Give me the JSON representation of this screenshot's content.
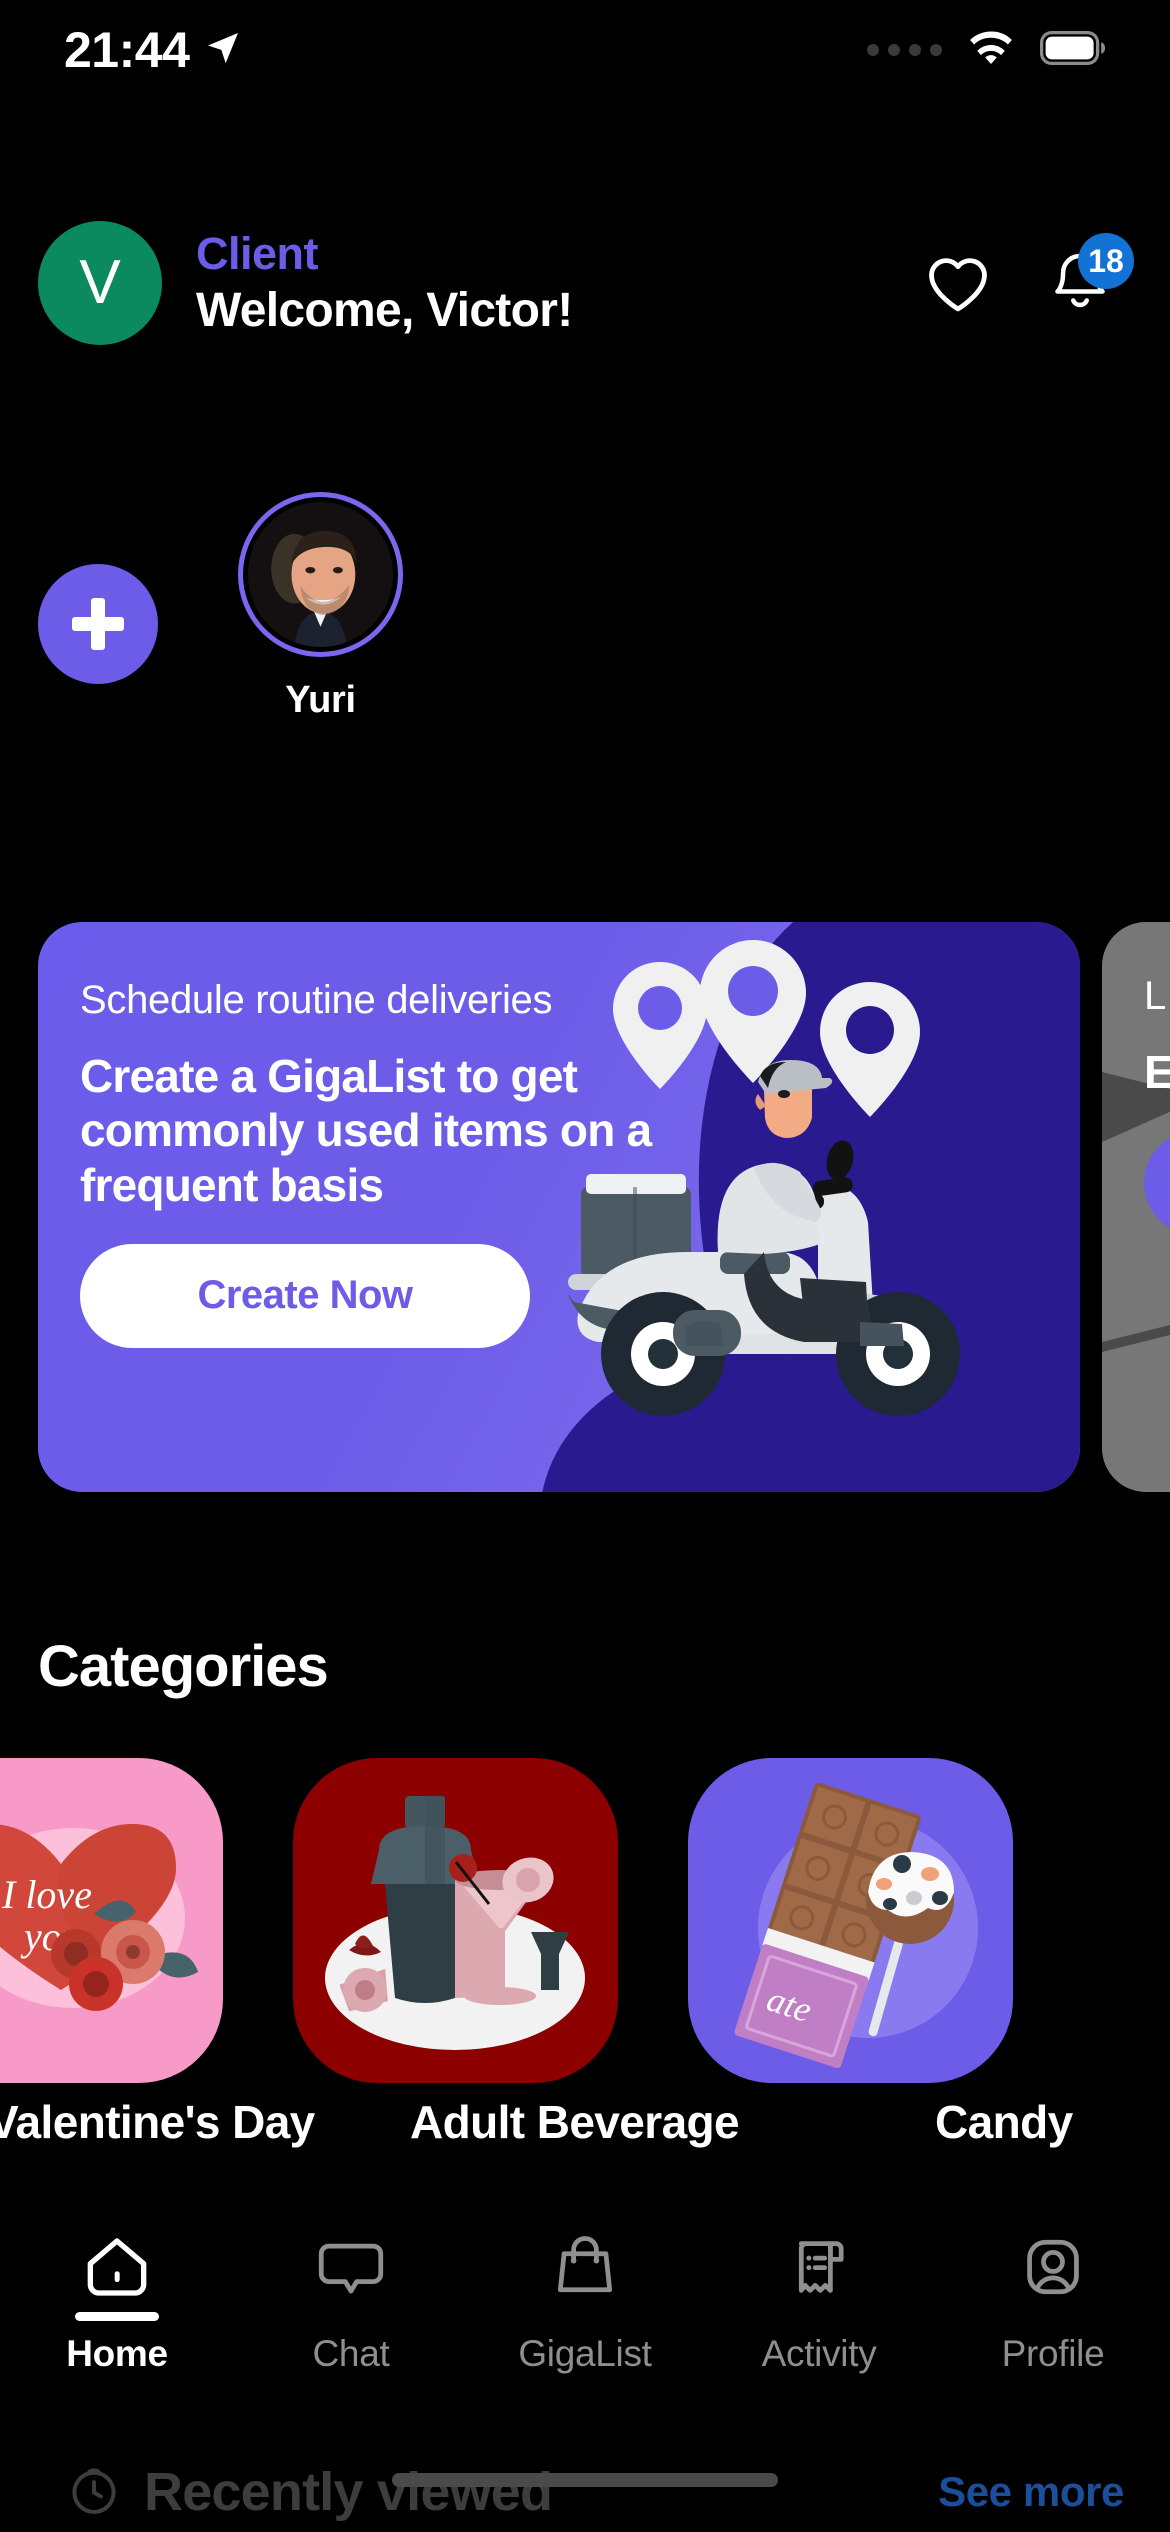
{
  "status_bar": {
    "time": "21:44",
    "location_icon": "location-arrow-icon",
    "signal_icon": "signal-dots-icon",
    "wifi_icon": "wifi-icon",
    "battery_icon": "battery-full-icon"
  },
  "header": {
    "avatar_initial": "V",
    "avatar_color": "#0b8a60",
    "role": "Client",
    "role_color": "#6C5CE7",
    "welcome": "Welcome, Victor!",
    "favorites_icon": "heart-icon",
    "notifications_icon": "bell-icon",
    "notification_count": "18",
    "badge_color": "#1273d4"
  },
  "stories": {
    "add_label": "plus-icon",
    "items": [
      {
        "name": "Yuri",
        "ring_color": "#7B66F0"
      }
    ]
  },
  "banners": [
    {
      "kicker": "Schedule routine deliveries",
      "title": "Create a GigaList to get commonly used items on a frequent basis",
      "button": "Create Now",
      "bg_color": "#6C5CE7",
      "button_text_color": "#6C5CE7",
      "art": "delivery-scooter-illustration"
    },
    {
      "kicker": "L",
      "title": "E i s",
      "button": "",
      "bg_color": "#4a4a4a",
      "button_color": "#6C5CE7"
    }
  ],
  "categories": {
    "title": "Categories",
    "items": [
      {
        "label": "Valentine's Day",
        "bg": "#F79AC8",
        "art": "heart-roses-illustration"
      },
      {
        "label": "Adult Beverage",
        "bg": "#8C0000",
        "art": "cocktail-shaker-illustration"
      },
      {
        "label": "Candy",
        "bg": "#6C5CE7",
        "art": "chocolate-bar-illustration"
      }
    ]
  },
  "bottom_nav": {
    "items": [
      {
        "label": "Home",
        "icon": "home-icon",
        "active": true
      },
      {
        "label": "Chat",
        "icon": "chat-bubble-icon",
        "active": false
      },
      {
        "label": "GigaList",
        "icon": "shopping-bag-icon",
        "active": false
      },
      {
        "label": "Activity",
        "icon": "receipt-icon",
        "active": false
      },
      {
        "label": "Profile",
        "icon": "person-icon",
        "active": false
      }
    ]
  },
  "recently_viewed": {
    "icon": "clock-icon",
    "label": "Recently viewed",
    "see_more": "See more",
    "see_more_color": "#1b4f9c"
  }
}
